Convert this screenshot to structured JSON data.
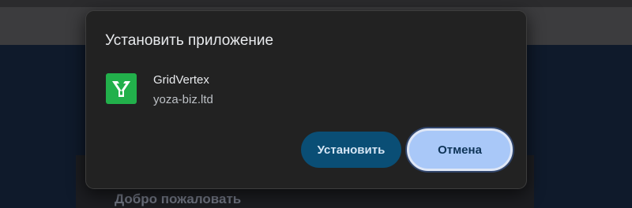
{
  "dialog": {
    "title": "Установить приложение",
    "app": {
      "name": "GridVertex",
      "origin": "yoza-biz.ltd",
      "icon": "gridvertex-logo-icon",
      "icon_color": "#22b04b"
    },
    "buttons": {
      "install_label": "Установить",
      "cancel_label": "Отмена"
    }
  },
  "background": {
    "welcome_text": "Добро пожаловать"
  },
  "colors": {
    "install_button": "#0a4e75",
    "cancel_button": "#a9c8f8",
    "dialog_background": "#222222"
  }
}
